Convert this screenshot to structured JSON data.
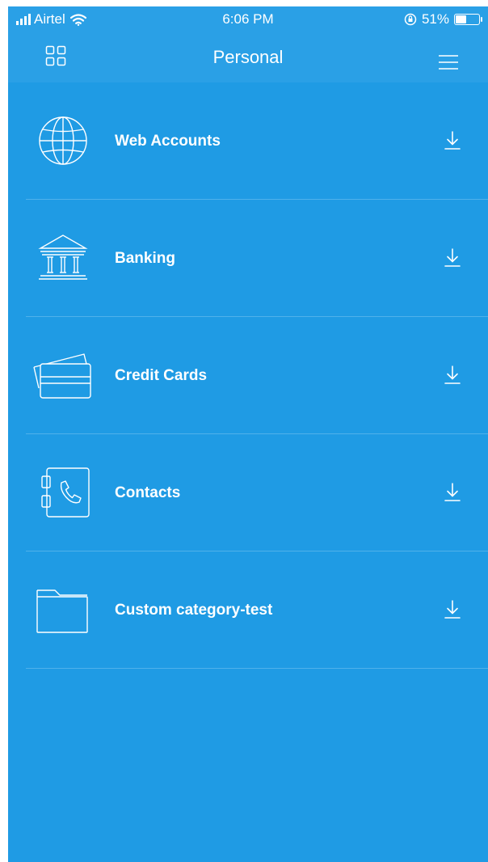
{
  "status_bar": {
    "carrier": "Airtel",
    "time": "6:06 PM",
    "battery": "51%",
    "battery_level": 0.51
  },
  "header": {
    "title": "Personal",
    "left_icon": "grid-icon",
    "right_icon": "hamburger-menu-icon"
  },
  "categories": [
    {
      "label": "Web Accounts",
      "icon": "globe-icon",
      "action_icon": "download-icon"
    },
    {
      "label": "Banking",
      "icon": "bank-icon",
      "action_icon": "download-icon"
    },
    {
      "label": "Credit Cards",
      "icon": "credit-cards-icon",
      "action_icon": "download-icon"
    },
    {
      "label": "Contacts",
      "icon": "contacts-book-icon",
      "action_icon": "download-icon"
    },
    {
      "label": "Custom category-test",
      "icon": "folder-icon",
      "action_icon": "download-icon"
    }
  ],
  "colors": {
    "background": "#1f9be4",
    "header": "#2aa0e6",
    "text": "#ffffff"
  }
}
